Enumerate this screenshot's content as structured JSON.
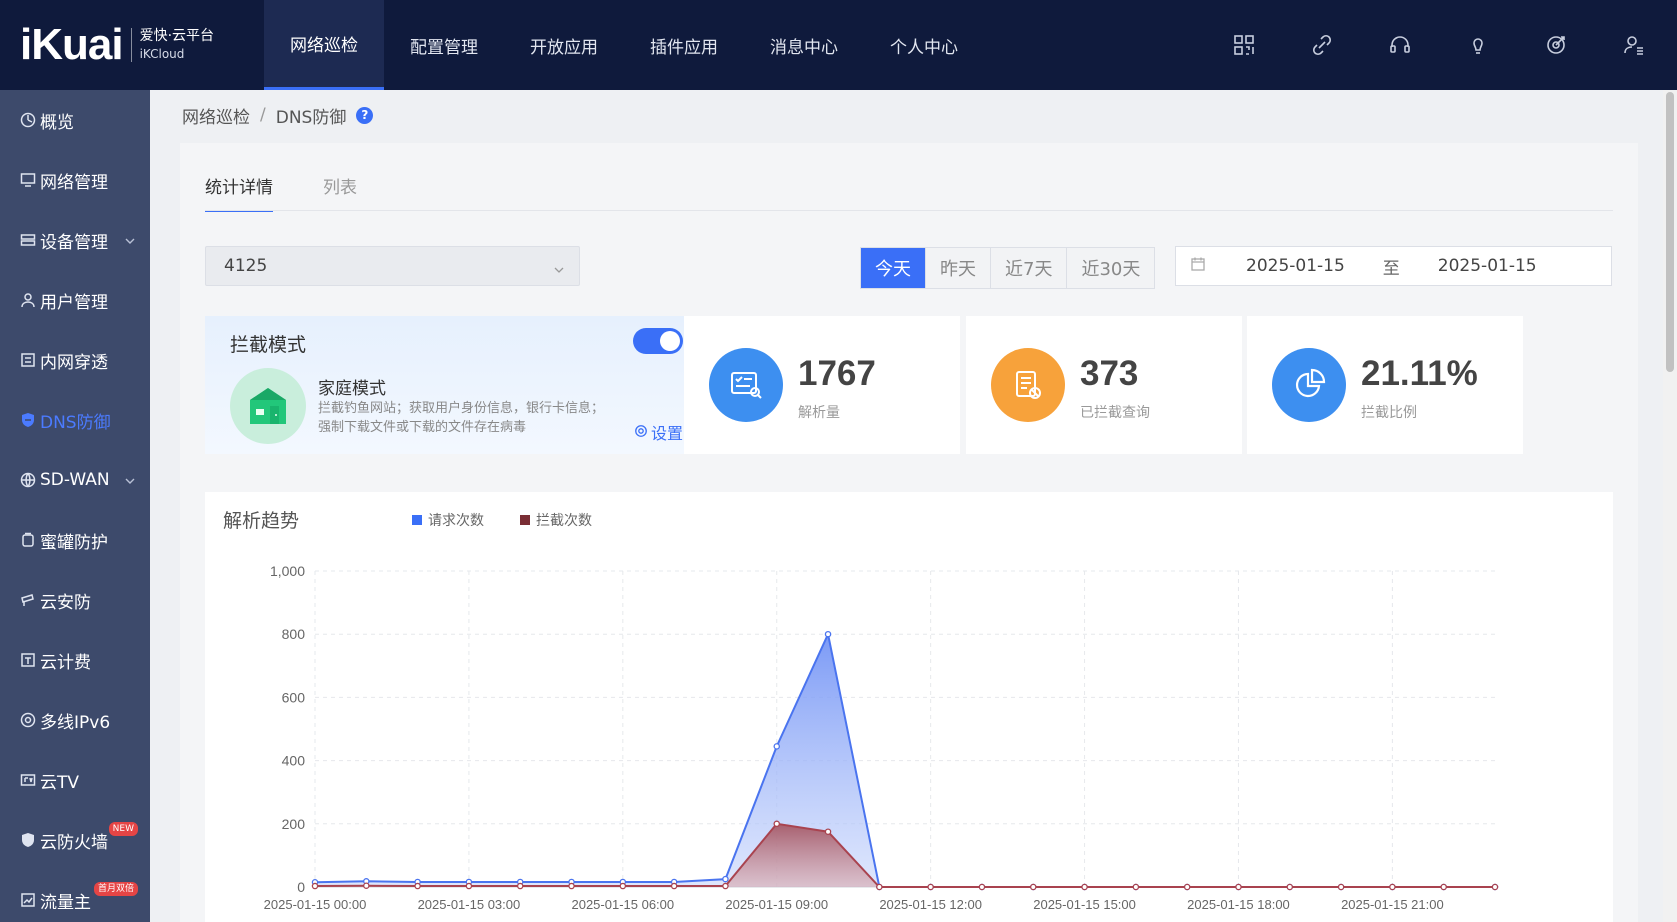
{
  "logo": {
    "brand": "iKuai",
    "cn": "爱快·云平台",
    "en": "iKCloud"
  },
  "nav": [
    {
      "label": "网络巡检",
      "active": true
    },
    {
      "label": "配置管理"
    },
    {
      "label": "开放应用"
    },
    {
      "label": "插件应用"
    },
    {
      "label": "消息中心"
    },
    {
      "label": "个人中心"
    }
  ],
  "top_icons": [
    "qrcode-icon",
    "link-icon",
    "headset-icon",
    "bulb-icon",
    "target-icon",
    "user-list-icon"
  ],
  "sidebar": [
    {
      "label": "概览",
      "icon": "dashboard-icon"
    },
    {
      "label": "网络管理",
      "icon": "monitor-icon"
    },
    {
      "label": "设备管理",
      "icon": "device-icon",
      "expandable": true
    },
    {
      "label": "用户管理",
      "icon": "user-icon"
    },
    {
      "label": "内网穿透",
      "icon": "tunnel-icon"
    },
    {
      "label": "DNS防御",
      "icon": "shield-icon",
      "active": true
    },
    {
      "label": "SD-WAN",
      "icon": "globe-icon",
      "expandable": true
    },
    {
      "label": "蜜罐防护",
      "icon": "honeypot-icon"
    },
    {
      "label": "云安防",
      "icon": "camera-icon"
    },
    {
      "label": "云计费",
      "icon": "billing-icon"
    },
    {
      "label": "多线IPv6",
      "icon": "ipv6-icon"
    },
    {
      "label": "云TV",
      "icon": "tv-icon"
    },
    {
      "label": "云防火墙",
      "icon": "firewall-icon",
      "badge": "NEW"
    },
    {
      "label": "流量主",
      "icon": "traffic-icon",
      "badge": "首月双倍"
    }
  ],
  "breadcrumb": {
    "parent": "网络巡检",
    "sep": "/",
    "current": "DNS防御",
    "help": "?"
  },
  "tabs": [
    {
      "label": "统计详情",
      "active": true
    },
    {
      "label": "列表"
    }
  ],
  "device_select": {
    "value": "4125"
  },
  "period": [
    {
      "label": "今天",
      "active": true
    },
    {
      "label": "昨天"
    },
    {
      "label": "近7天"
    },
    {
      "label": "近30天"
    }
  ],
  "date_range": {
    "start": "2025-01-15",
    "sep": "至",
    "end": "2025-01-15"
  },
  "intercept": {
    "title": "拦截模式",
    "enabled": true,
    "mode_name": "家庭模式",
    "mode_desc": "拦截钓鱼网站；获取用户身份信息，银行卡信息； 强制下载文件或下载的文件存在病毒",
    "setting_label": "设置"
  },
  "stats": [
    {
      "value": "1767",
      "label": "解析量",
      "color": "#3d8ff0",
      "icon": "query-icon"
    },
    {
      "value": "373",
      "label": "已拦截查询",
      "color": "#f7a23b",
      "icon": "blocked-doc-icon"
    },
    {
      "value": "21.11%",
      "label": "拦截比例",
      "color": "#3d8ff0",
      "icon": "pie-icon"
    }
  ],
  "chart_data": {
    "type": "area",
    "title": "解析趋势",
    "y_ticks": [
      "1,000",
      "800",
      "600",
      "400",
      "200",
      "0"
    ],
    "ylim": [
      0,
      1000
    ],
    "x_tick_labels": [
      "2025-01-15 00:00",
      "2025-01-15 03:00",
      "2025-01-15 06:00",
      "2025-01-15 09:00",
      "2025-01-15 12:00",
      "2025-01-15 15:00",
      "2025-01-15 18:00",
      "2025-01-15 21:00"
    ],
    "x_count": 24,
    "grid": true,
    "legend_position": "top-left",
    "series": [
      {
        "name": "请求次数",
        "color": "#3a6ff7",
        "values": [
          15,
          18,
          16,
          16,
          16,
          16,
          16,
          16,
          25,
          445,
          800,
          0,
          0,
          0,
          0,
          0,
          0,
          0,
          0,
          0,
          0,
          0,
          0,
          0
        ]
      },
      {
        "name": "拦截次数",
        "color": "#7a2e35",
        "values": [
          3,
          4,
          3,
          3,
          3,
          3,
          3,
          3,
          3,
          200,
          175,
          0,
          0,
          0,
          0,
          0,
          0,
          0,
          0,
          0,
          0,
          0,
          0,
          0
        ]
      }
    ]
  }
}
